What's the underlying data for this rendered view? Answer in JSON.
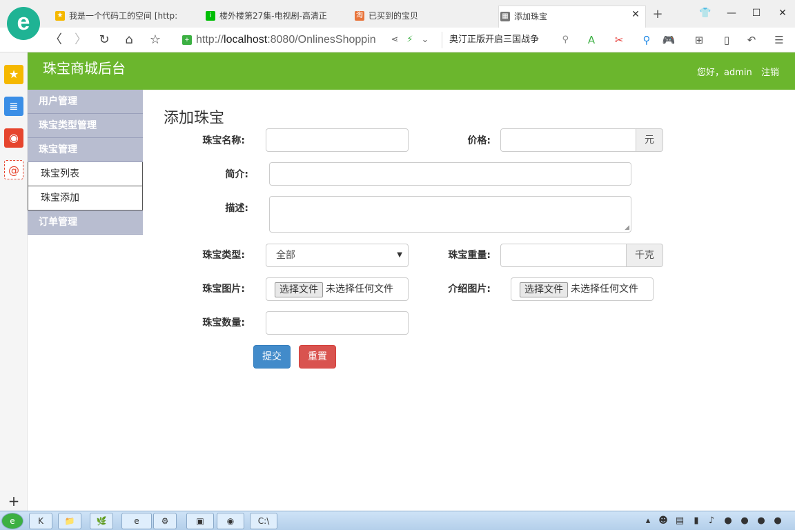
{
  "browser": {
    "logo_glyph": "e",
    "tabs": [
      {
        "label": "我是一个代码工的空间 [http:",
        "icon": "star-icon",
        "icon_color": "#f5b800"
      },
      {
        "label": "楼外楼第27集-电视剧-高清正",
        "icon": "iqiyi-icon",
        "icon_color": "#00be06"
      },
      {
        "label": "已买到的宝贝",
        "icon": "taobao-icon",
        "icon_color": "#e8743b"
      },
      {
        "label": "添加珠宝",
        "icon": "page-icon",
        "icon_color": "#777777"
      }
    ],
    "url_prefix": "http://",
    "url_host": "localhost",
    "url_rest": ":8080/OnlinesShoppin",
    "search_text": "奥汀正版开启三国战争"
  },
  "header": {
    "brand": "珠宝商城后台",
    "greeting": "您好，admin",
    "logout": "注销",
    "color": "#6bb62d"
  },
  "menu": {
    "user_mgmt": "用户管理",
    "type_mgmt": "珠宝类型管理",
    "jewel_mgmt": "珠宝管理",
    "jewel_list": "珠宝列表",
    "jewel_add": "珠宝添加",
    "order_mgmt": "订单管理"
  },
  "form": {
    "title": "添加珠宝",
    "name_label": "珠宝名称:",
    "price_label": "价格:",
    "price_unit": "元",
    "intro_label": "简介:",
    "desc_label": "描述:",
    "type_label": "珠宝类型:",
    "type_selected": "全部",
    "weight_label": "珠宝重量:",
    "weight_unit": "千克",
    "image_label": "珠宝图片:",
    "intro_image_label": "介绍图片:",
    "file_button": "选择文件",
    "file_none": "未选择任何文件",
    "qty_label": "珠宝数量:",
    "submit": "提交",
    "reset": "重置",
    "submit_color": "#428bca",
    "reset_color": "#d9534f"
  },
  "taskbar": {
    "apps": [
      "K",
      "📁",
      "🌿",
      "e",
      "⚙",
      "▣",
      "◉",
      "C:\\"
    ]
  }
}
